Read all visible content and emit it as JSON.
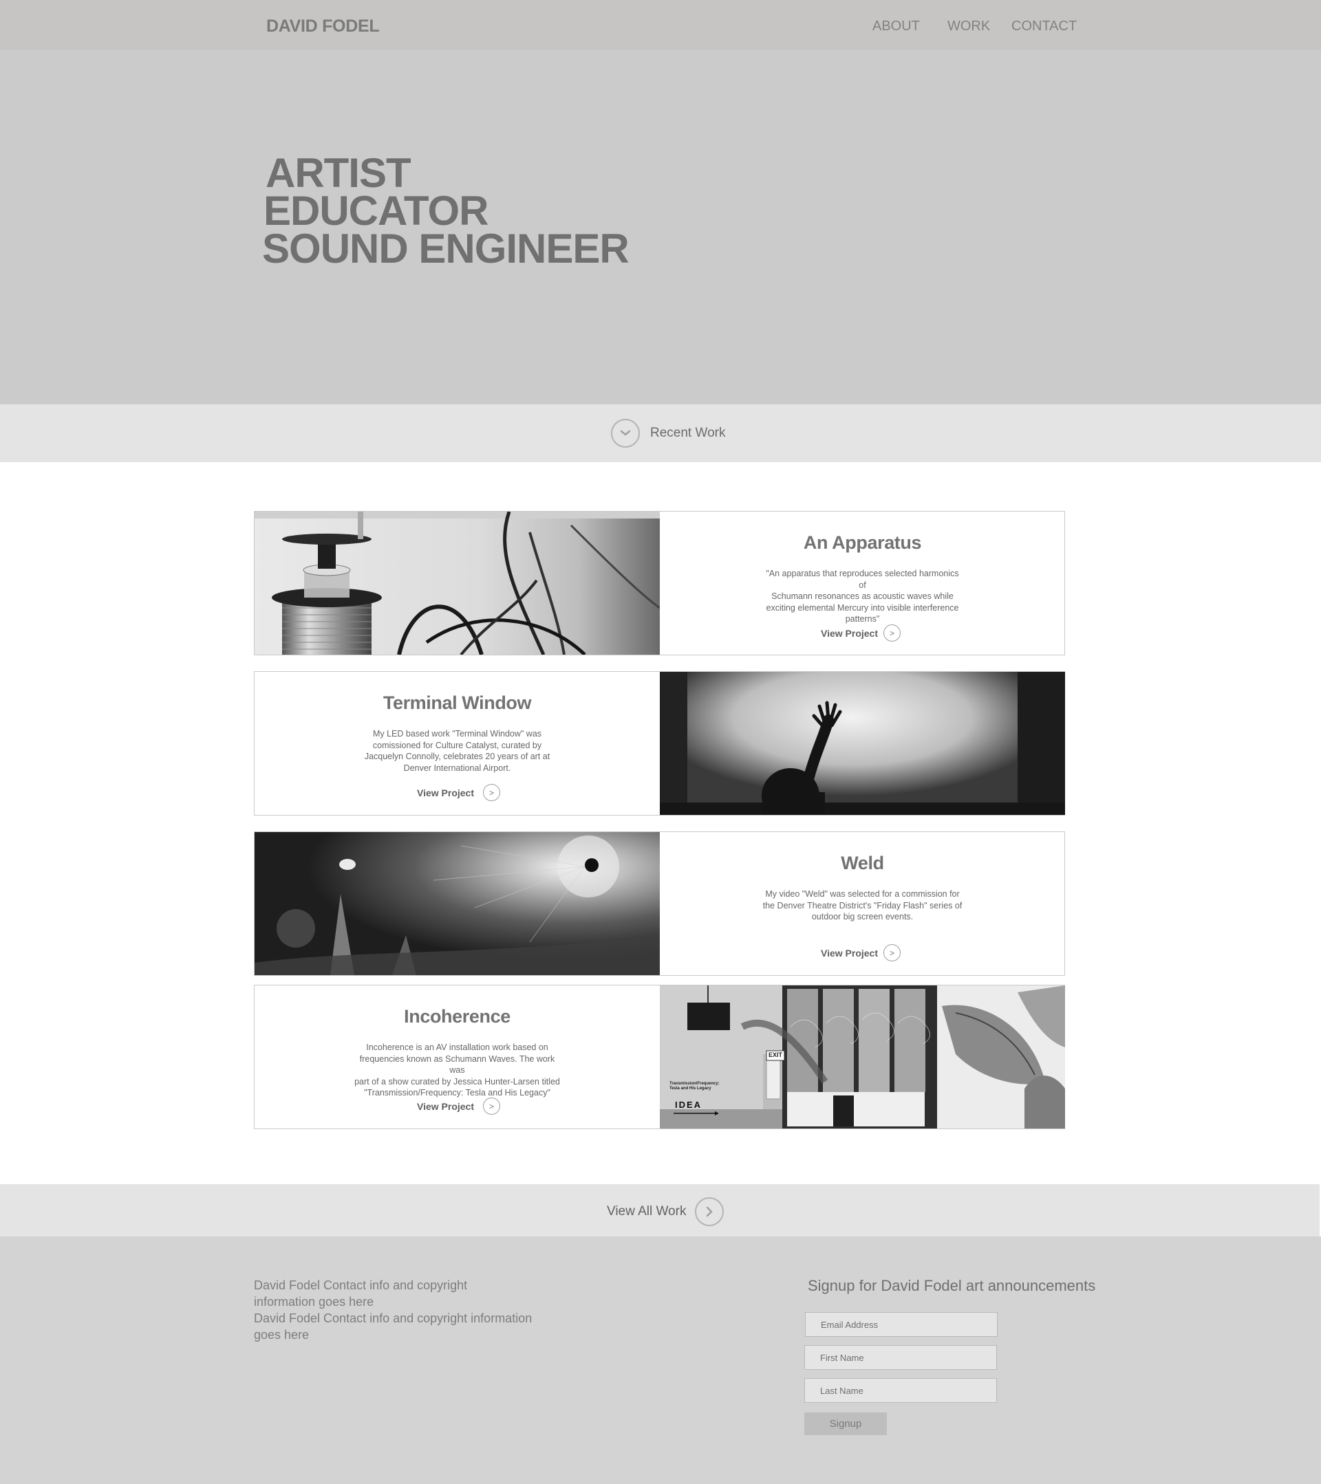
{
  "header": {
    "logo": "DAVID FODEL",
    "nav": [
      "ABOUT",
      "WORK",
      "CONTACT"
    ]
  },
  "hero": {
    "lines": [
      "ARTIST",
      "EDUCATOR",
      "SOUND ENGINEER"
    ]
  },
  "recent": {
    "label": "Recent Work"
  },
  "projects": [
    {
      "title": "An Apparatus",
      "description": [
        "\"An apparatus that reproduces selected harmonics of",
        "Schumann resonances as acoustic waves while",
        "exciting elemental Mercury into visible interference",
        "patterns\""
      ],
      "link": "View Project"
    },
    {
      "title": "Terminal Window",
      "description": [
        "My LED based work \"Terminal Window\" was",
        "comissioned for Culture Catalyst, curated by",
        "Jacquelyn Connolly, celebrates 20 years of art at",
        "Denver International Airport."
      ],
      "link": "View Project"
    },
    {
      "title": "Weld",
      "description": [
        "My video \"Weld\" was selected for a commission for",
        "the Denver Theatre District's \"Friday Flash\" series of",
        "outdoor big screen events."
      ],
      "link": "View Project"
    },
    {
      "title": "Incoherence",
      "description": [
        "Incoherence is an AV installation work based on",
        "frequencies known as Schumann Waves. The work was",
        "part of a show curated by Jessica Hunter-Larsen titled",
        "\"Transmission/Frequency: Tesla and His Legacy\""
      ],
      "link": "View Project"
    }
  ],
  "photo_text": {
    "exit": "EXIT",
    "poster_title": "Transmission/Frequency:",
    "poster_sub": "Tesla and His Legacy",
    "idea": "IDEA"
  },
  "view_all": {
    "label": "View All Work"
  },
  "footer": {
    "text_lines": [
      "David Fodel Contact info and copyright",
      "information goes here",
      "David Fodel Contact info and copyright information",
      "goes here"
    ],
    "signup_title": "Signup for David Fodel art announcements",
    "email_placeholder": "Email Address",
    "first_placeholder": "First Name",
    "last_placeholder": "Last Name",
    "signup_button": "Signup"
  }
}
